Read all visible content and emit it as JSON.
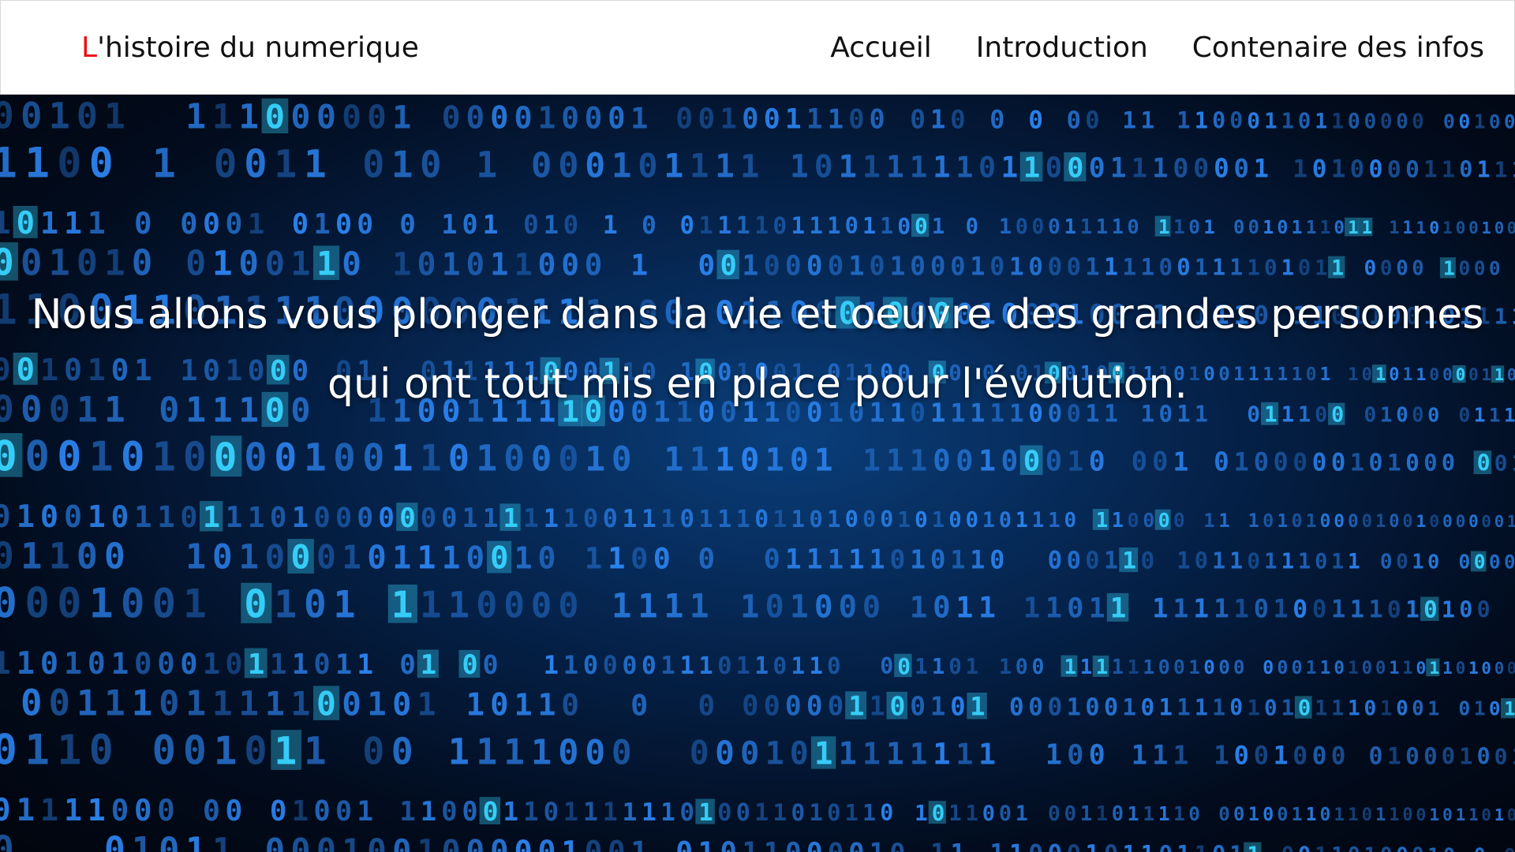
{
  "brand": {
    "initial": "L",
    "rest": "'histoire du numerique",
    "accent_color": "#e8141a"
  },
  "nav": {
    "items": [
      {
        "label": "Accueil"
      },
      {
        "label": "Introduction"
      },
      {
        "label": "Contenaire des infos"
      }
    ]
  },
  "hero": {
    "line1": "Nous allons vous plonger dans la vie et oeuvre des grandes personnes",
    "line2": "qui ont tout mis en place pour l'évolution.",
    "background_image": "binary-code-matrix",
    "colors": {
      "digit": "#2f8cff",
      "glow": "#37d4ff",
      "dark": "#01050d"
    }
  }
}
